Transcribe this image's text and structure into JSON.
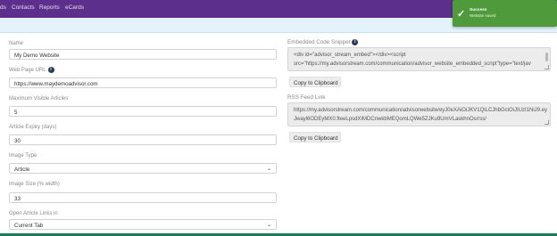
{
  "nav": {
    "items": [
      "ds",
      "Contacts",
      "Reports",
      "eCards"
    ]
  },
  "toast": {
    "title": "Success",
    "message": "Website saved",
    "color": "#4f9a3b",
    "icon": "checkmark-icon"
  },
  "form": {
    "name": {
      "label": "Name",
      "value": "My Demo Website"
    },
    "url": {
      "label": "Web Page URL",
      "value": "https://www.maydemoadvisor.com",
      "icon": "info-icon"
    },
    "max_articles": {
      "label": "Maximum Visible Articles",
      "value": "5"
    },
    "expiry": {
      "label": "Article Expiry (days)",
      "value": "30"
    },
    "image_type": {
      "label": "Image Type",
      "value": "Article"
    },
    "image_size": {
      "label": "Image Size (% width)",
      "value": "33"
    },
    "open_links": {
      "label": "Open Article Links in",
      "value": "Current Tab"
    }
  },
  "embed": {
    "label": "Embedded Code Snippet",
    "icon": "info-icon",
    "line1": "<div id=\"advisor_stream_embed\"></div><script",
    "line2": "src=\"https://my.advisorstream.com/communication/advisor_website_embedded_script\"type=\"text/jav",
    "copy_label": "Copy to Clipboard"
  },
  "rss": {
    "label": "RSS Feed Link",
    "line1": "https://my.advisorstream.com/communication/advisorwebsite/eyJ0eXAiOiJKV1QiLCJhbGciOiJIUzI1NiJ9.ey",
    "line2": "Jwayl6ODEyMX0.fteeLpsdXIMDCnwkbMEQomLQWe5ZJKu9UmVLaskhnOs/rss/",
    "copy_label": "Copy to Clipboard"
  },
  "colors": {
    "nav": "#5c2f8c",
    "banner": "#e3f2fb",
    "success": "#4f9a3b"
  }
}
